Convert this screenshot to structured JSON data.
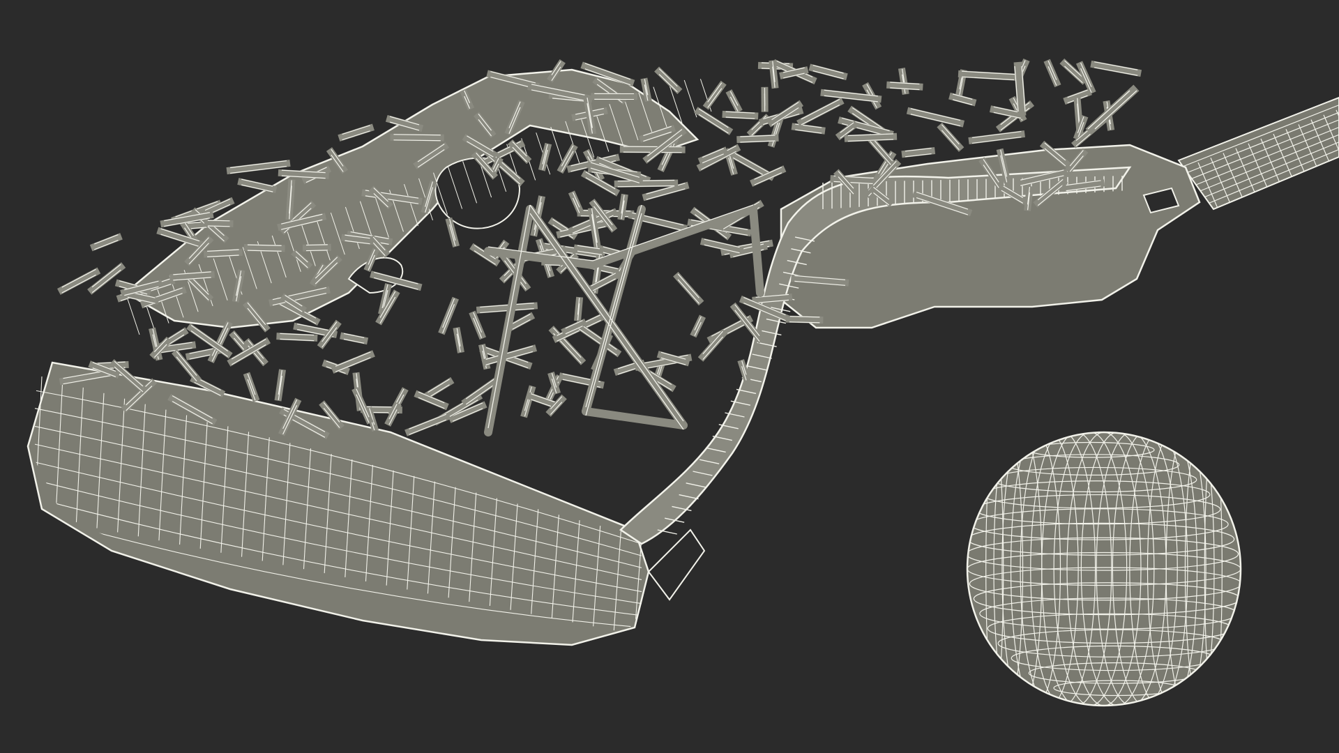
{
  "scene": {
    "subject": "lacrosse-stick-head-and-ball",
    "background_color": "#2b2b2b",
    "mesh_fill_color": "#78786e",
    "mesh_fill_light_color": "#8a8a80",
    "wire_color": "#f2f2ea",
    "shadow_color": "#5a5a52",
    "mesh_objects": [
      {
        "name": "stick-head"
      },
      {
        "name": "stick-shaft"
      },
      {
        "name": "lacrosse-ball"
      }
    ]
  }
}
